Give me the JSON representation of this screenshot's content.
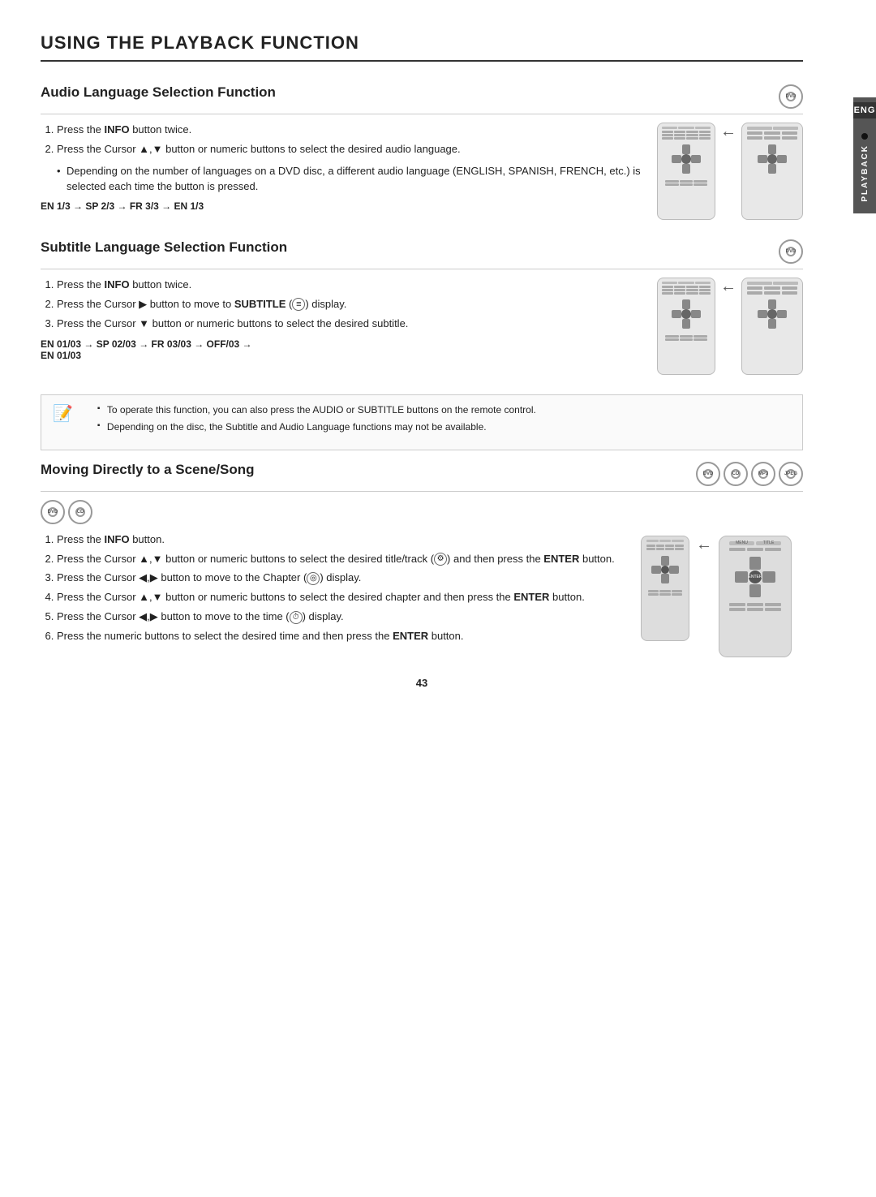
{
  "page": {
    "title": "USING THE PLAYBACK FUNCTION",
    "number": "43",
    "lang_tab": "ENG",
    "side_label": "PLAYBACK"
  },
  "sections": {
    "audio": {
      "title": "Audio Language Selection Function",
      "badge": "DVD",
      "steps": [
        {
          "num": 1,
          "text": "Press the ",
          "bold": "INFO",
          "rest": " button twice."
        },
        {
          "num": 2,
          "text": "Press the Cursor ▲,▼ button or numeric buttons to select the desired audio language."
        }
      ],
      "bullet": "Depending on the number of languages on a DVD disc, a different audio language (ENGLISH, SPANISH, FRENCH, etc.) is selected each time the button is pressed.",
      "sequence": "EN 1/3 → SP 2/3 → FR 3/3 → EN 1/3"
    },
    "subtitle": {
      "title": "Subtitle Language Selection Function",
      "badge": "DVD",
      "steps": [
        {
          "num": 1,
          "text": "Press the ",
          "bold": "INFO",
          "rest": " button twice."
        },
        {
          "num": 2,
          "text": "Press the Cursor ▶ button to move to ",
          "bold": "SUBTITLE",
          "icon": "≡",
          "rest": " display."
        },
        {
          "num": 3,
          "text": "Press the Cursor ▼ button or numeric buttons to select the desired subtitle."
        }
      ],
      "sequence": "EN 01/03 → SP 02/03 → FR 03/03 → OFF/03 → EN 01/03"
    },
    "note": {
      "bullets": [
        "To operate this function, you can also press the AUDIO or SUBTITLE buttons on the remote control.",
        "Depending on the disc, the Subtitle and Audio Language functions may not be available."
      ]
    },
    "moving": {
      "title": "Moving Directly to a Scene/Song",
      "badges": [
        "DVD",
        "CD",
        "MP3",
        "JPEG"
      ],
      "sub_badges": [
        "DVD",
        "CD"
      ],
      "steps": [
        {
          "num": 1,
          "text": "Press the ",
          "bold": "INFO",
          "rest": " button."
        },
        {
          "num": 2,
          "text": "Press the Cursor ▲,▼ button or numeric buttons to select the desired title/track (",
          "icon": "⚙",
          "rest": ") and then press the ",
          "bold2": "ENTER",
          "rest2": " button."
        },
        {
          "num": 3,
          "text": "Press the Cursor ◀,▶ button to move to the Chapter (",
          "icon": "◎",
          "rest": ") display."
        },
        {
          "num": 4,
          "text": "Press the Cursor ▲,▼ button or numeric buttons to select the desired chapter and then press the ",
          "bold": "ENTER",
          "rest": " button."
        },
        {
          "num": 5,
          "text": "Press the Cursor ◀,▶ button to move to the time (",
          "icon": "⏱",
          "rest": ") display."
        },
        {
          "num": 6,
          "text": "Press the numeric buttons to select the desired time and then press the ",
          "bold": "ENTER",
          "rest": " button."
        }
      ]
    }
  }
}
